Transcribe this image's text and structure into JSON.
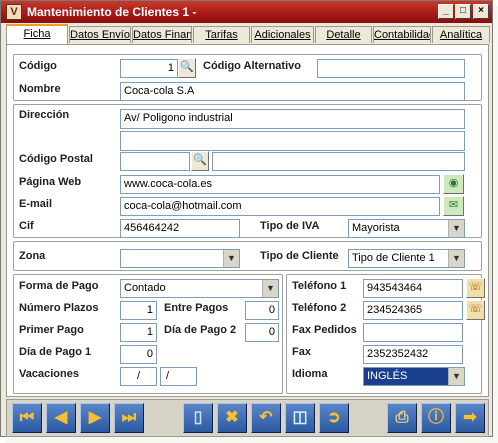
{
  "window": {
    "title": "Mantenimiento de Clientes 1 -",
    "app_icon": "V",
    "minimize": "_",
    "maximize": "□",
    "close": "×"
  },
  "tabs": [
    {
      "label": "Ficha",
      "active": true
    },
    {
      "label": "Datos Envío"
    },
    {
      "label": "Datos Finan"
    },
    {
      "label": "Tarifas"
    },
    {
      "label": "Adicionales"
    },
    {
      "label": "Detalle"
    },
    {
      "label": "Contabilidad"
    },
    {
      "label": "Analítica"
    }
  ],
  "fields": {
    "codigo": {
      "label": "Código",
      "value": "1"
    },
    "codigo_alt": {
      "label": "Código Alternativo",
      "value": ""
    },
    "nombre": {
      "label": "Nombre",
      "value": "Coca-cola S.A"
    },
    "direccion": {
      "label": "Dirección",
      "value": "Av/ Poligono industrial",
      "value2": ""
    },
    "codigo_postal": {
      "label": "Código Postal",
      "value": "",
      "city": ""
    },
    "pagina_web": {
      "label": "Página Web",
      "value": "www.coca-cola.es"
    },
    "email": {
      "label": "E-mail",
      "value": "coca-cola@hotmail.com"
    },
    "cif": {
      "label": "Cif",
      "value": "456464242"
    },
    "tipo_iva": {
      "label": "Tipo de IVA",
      "value": "Mayorista"
    },
    "zona": {
      "label": "Zona",
      "value": ""
    },
    "tipo_cliente": {
      "label": "Tipo de Cliente",
      "value": "Tipo de Cliente 1"
    },
    "forma_pago": {
      "label": "Forma de Pago",
      "value": "Contado"
    },
    "numero_plazos": {
      "label": "Número Plazos",
      "value": "1"
    },
    "entre_pagos": {
      "label": "Entre Pagos",
      "value": "0"
    },
    "primer_pago": {
      "label": "Primer Pago",
      "value": "1"
    },
    "dia_pago_2": {
      "label": "Día de Pago 2",
      "value": "0"
    },
    "dia_pago_1": {
      "label": "Día de Pago 1",
      "value": "0"
    },
    "vacaciones": {
      "label": "Vacaciones",
      "value1": "/",
      "value2": "/"
    },
    "telefono1": {
      "label": "Teléfono 1",
      "value": "943543464"
    },
    "telefono2": {
      "label": "Teléfono 2",
      "value": "234524365"
    },
    "fax_pedidos": {
      "label": "Fax Pedidos",
      "value": ""
    },
    "fax": {
      "label": "Fax",
      "value": "2352352432"
    },
    "idioma": {
      "label": "Idioma",
      "value": "INGLÉS"
    }
  },
  "toolbar": {
    "first": "first-record-icon",
    "prev": "prev-record-icon",
    "next": "next-record-icon",
    "last": "last-record-icon",
    "new": "new-document-icon",
    "delete": "delete-icon",
    "undo": "undo-icon",
    "save": "save-icon",
    "exit": "exit-door-icon",
    "print": "print-icon",
    "info": "info-icon",
    "export": "export-icon"
  },
  "colors": {
    "title_bar": "#a81a1a",
    "toolbar_button": "#2c5aa0",
    "selected_field": "#1b3f8f",
    "active_tab_accent": "#e8a030"
  }
}
